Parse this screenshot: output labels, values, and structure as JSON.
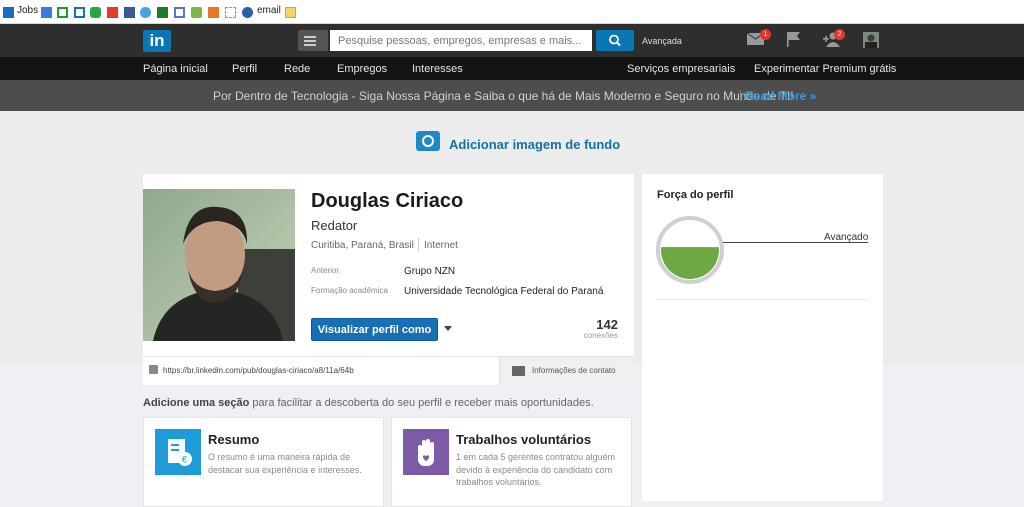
{
  "bookmarks": {
    "jobs": "Jobs",
    "email": "email"
  },
  "header": {
    "logo": "in",
    "search_placeholder": "Pesquise pessoas, empregos, empresas e mais...",
    "advanced": "Avançada",
    "messages_count": "1",
    "connections_count": "2"
  },
  "nav": {
    "items": [
      "Página inicial",
      "Perfil",
      "Rede",
      "Empregos",
      "Interesses"
    ],
    "business": "Serviços empresariais",
    "premium": "Experimentar Premium grátis"
  },
  "banner": {
    "text": "Por Dentro de Tecnologia - Siga Nossa Página e Saiba o que há de Mais Moderno e Seguro no Mundo de TI!",
    "separator": "|",
    "link": "Read More »"
  },
  "cover": {
    "add_background": "Adicionar imagem de fundo"
  },
  "profile": {
    "name": "Douglas Ciriaco",
    "headline": "Redator",
    "location": "Curitiba, Paraná, Brasil",
    "industry": "Internet",
    "previous_label": "Anterior",
    "previous_value": "Grupo NZN",
    "education_label": "Formação acadêmica",
    "education_value": "Universidade Tecnológica Federal do Paraná",
    "view_button": "Visualizar perfil como",
    "connections_count": "142",
    "connections_label": "conexões",
    "url": "https://br.linkedin.com/pub/douglas-ciriaco/a8/11a/64b",
    "contact_info": "Informações de contato"
  },
  "strength": {
    "title": "Força do perfil",
    "level": "Avançado",
    "fill_fraction": 0.55,
    "fill_color": "#6ea843"
  },
  "add_section": {
    "bold": "Adicione uma seção",
    "rest": " para facilitar a descoberta do seu perfil e receber mais oportunidades.",
    "cards": [
      {
        "title": "Resumo",
        "desc": "O resumo é uma maneira rápida de destacar sua experiência e interesses.",
        "icon_color": "#1d9cd8"
      },
      {
        "title": "Trabalhos voluntários",
        "desc": "1 em cada 5 gerentes contratou alguém devido à experiência do candidato com trabalhos voluntários.",
        "icon_color": "#7d5aa6"
      }
    ]
  }
}
